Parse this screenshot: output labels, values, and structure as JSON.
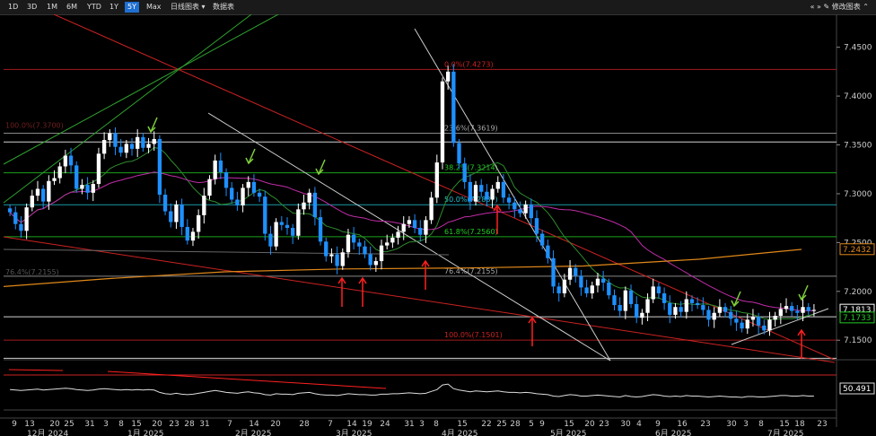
{
  "toolbar": {
    "ranges": [
      "1D",
      "3D",
      "1M",
      "6M",
      "YTD",
      "1Y",
      "5Y",
      "Max"
    ],
    "active_range": "5Y",
    "chart_type": "日线图表",
    "data_table": "数据表",
    "right_label": "修改图表"
  },
  "colors": {
    "up": "#ffffff",
    "down": "#1e90ff",
    "ma_green": "#2e8b2e",
    "ma_magenta": "#c02ca8",
    "ma_orange": "#e0881a",
    "fib_red": "#cc2222",
    "fib_green": "#22cc22",
    "fib_cyan": "#22c0d0",
    "trend_white": "#cccccc",
    "arrow_red": "#ff2020",
    "arrow_green": "#7fd03a"
  },
  "chart_data": {
    "type": "candlestick",
    "ylim": [
      7.13,
      7.48
    ],
    "y_ticks": [
      "7.4500",
      "7.4000",
      "7.3500",
      "7.3000",
      "7.2500",
      "7.2000",
      "7.1500"
    ],
    "x_ticks": [
      "9",
      "13",
      "20",
      "25",
      "31",
      "3",
      "8",
      "15",
      "20",
      "23",
      "28",
      "31",
      "7",
      "14",
      "20",
      "28",
      "7",
      "14",
      "19",
      "24",
      "31",
      "3",
      "8",
      "15",
      "22",
      "25",
      "28",
      "5",
      "9",
      "15",
      "20",
      "23",
      "30",
      "4",
      "9",
      "16",
      "23",
      "30",
      "3",
      "8",
      "15",
      "18",
      "23"
    ],
    "months": [
      "12月 2024",
      "1月 2025",
      "2月 2025",
      "3月 2025",
      "4月 2025",
      "5月 2025",
      "6月 2025",
      "7月 2025"
    ],
    "price_badges": [
      {
        "value": "7.2432",
        "color": "#e0881a"
      },
      {
        "value": "7.1813",
        "color": "#ffffff"
      },
      {
        "value": "7.1733",
        "color": "#22cc22"
      }
    ],
    "fib_levels": [
      {
        "label": "0.0%(7.4273)",
        "value": 7.4273,
        "color": "#cc2222"
      },
      {
        "label": "23.6%(7.3619)",
        "value": 7.3619,
        "color": "#aaaaaa"
      },
      {
        "label": "38.2%(7.3214)",
        "value": 7.3214,
        "color": "#22cc22"
      },
      {
        "label": "50.0%(7.2887)",
        "value": 7.2887,
        "color": "#22c0d0"
      },
      {
        "label": "61.8%(7.2560)",
        "value": 7.256,
        "color": "#22cc22"
      },
      {
        "label": "76.4%(7.2155)",
        "value": 7.2155,
        "color": "#aaaaaa"
      },
      {
        "label": "100.0%(7.1501)",
        "value": 7.1501,
        "color": "#cc2222"
      }
    ],
    "ghost_labels": [
      "100.0%(7.3700)",
      "76.4%(7.2155)"
    ],
    "closes": [
      7.281,
      7.269,
      7.262,
      7.286,
      7.298,
      7.305,
      7.292,
      7.313,
      7.316,
      7.328,
      7.339,
      7.329,
      7.305,
      7.309,
      7.301,
      7.31,
      7.341,
      7.355,
      7.362,
      7.348,
      7.342,
      7.351,
      7.346,
      7.358,
      7.347,
      7.351,
      7.356,
      7.299,
      7.282,
      7.271,
      7.289,
      7.266,
      7.252,
      7.261,
      7.278,
      7.298,
      7.315,
      7.334,
      7.322,
      7.306,
      7.294,
      7.288,
      7.306,
      7.312,
      7.301,
      7.297,
      7.259,
      7.246,
      7.271,
      7.268,
      7.265,
      7.257,
      7.284,
      7.291,
      7.301,
      7.276,
      7.251,
      7.236,
      7.238,
      7.226,
      7.24,
      7.258,
      7.25,
      7.246,
      7.238,
      7.227,
      7.231,
      7.247,
      7.25,
      7.255,
      7.261,
      7.269,
      7.273,
      7.265,
      7.258,
      7.273,
      7.296,
      7.332,
      7.415,
      7.425,
      7.352,
      7.331,
      7.312,
      7.292,
      7.309,
      7.302,
      7.294,
      7.305,
      7.312,
      7.296,
      7.291,
      7.284,
      7.28,
      7.289,
      7.275,
      7.259,
      7.247,
      7.234,
      7.205,
      7.198,
      7.212,
      7.224,
      7.216,
      7.204,
      7.198,
      7.206,
      7.213,
      7.209,
      7.196,
      7.186,
      7.18,
      7.201,
      7.187,
      7.173,
      7.178,
      7.192,
      7.205,
      7.198,
      7.188,
      7.176,
      7.184,
      7.179,
      7.192,
      7.188,
      7.186,
      7.181,
      7.171,
      7.178,
      7.184,
      7.179,
      7.172,
      7.168,
      7.162,
      7.171,
      7.174,
      7.165,
      7.16,
      7.171,
      7.175,
      7.182,
      7.185,
      7.18,
      7.178,
      7.184,
      7.18,
      7.181
    ],
    "osc": [
      0.56,
      0.55,
      0.54,
      0.55,
      0.56,
      0.57,
      0.55,
      0.56,
      0.57,
      0.58,
      0.59,
      0.58,
      0.56,
      0.55,
      0.54,
      0.55,
      0.57,
      0.58,
      0.57,
      0.56,
      0.55,
      0.56,
      0.55,
      0.56,
      0.55,
      0.56,
      0.55,
      0.5,
      0.47,
      0.46,
      0.48,
      0.46,
      0.45,
      0.46,
      0.48,
      0.5,
      0.52,
      0.54,
      0.52,
      0.5,
      0.49,
      0.48,
      0.5,
      0.51,
      0.49,
      0.48,
      0.45,
      0.44,
      0.47,
      0.46,
      0.46,
      0.45,
      0.48,
      0.49,
      0.5,
      0.47,
      0.45,
      0.44,
      0.44,
      0.43,
      0.45,
      0.47,
      0.46,
      0.45,
      0.45,
      0.44,
      0.44,
      0.46,
      0.46,
      0.47,
      0.47,
      0.48,
      0.49,
      0.48,
      0.47,
      0.48,
      0.52,
      0.56,
      0.66,
      0.68,
      0.58,
      0.55,
      0.53,
      0.51,
      0.53,
      0.52,
      0.51,
      0.52,
      0.53,
      0.51,
      0.5,
      0.5,
      0.49,
      0.5,
      0.49,
      0.47,
      0.46,
      0.45,
      0.42,
      0.41,
      0.43,
      0.45,
      0.44,
      0.42,
      0.42,
      0.43,
      0.44,
      0.43,
      0.42,
      0.41,
      0.4,
      0.43,
      0.41,
      0.4,
      0.41,
      0.43,
      0.45,
      0.44,
      0.42,
      0.41,
      0.42,
      0.41,
      0.43,
      0.42,
      0.42,
      0.41,
      0.4,
      0.41,
      0.42,
      0.41,
      0.4,
      0.4,
      0.39,
      0.41,
      0.41,
      0.4,
      0.4,
      0.41,
      0.42,
      0.43,
      0.43,
      0.42,
      0.42,
      0.43,
      0.42,
      0.42
    ],
    "osc_value": "50.491"
  }
}
